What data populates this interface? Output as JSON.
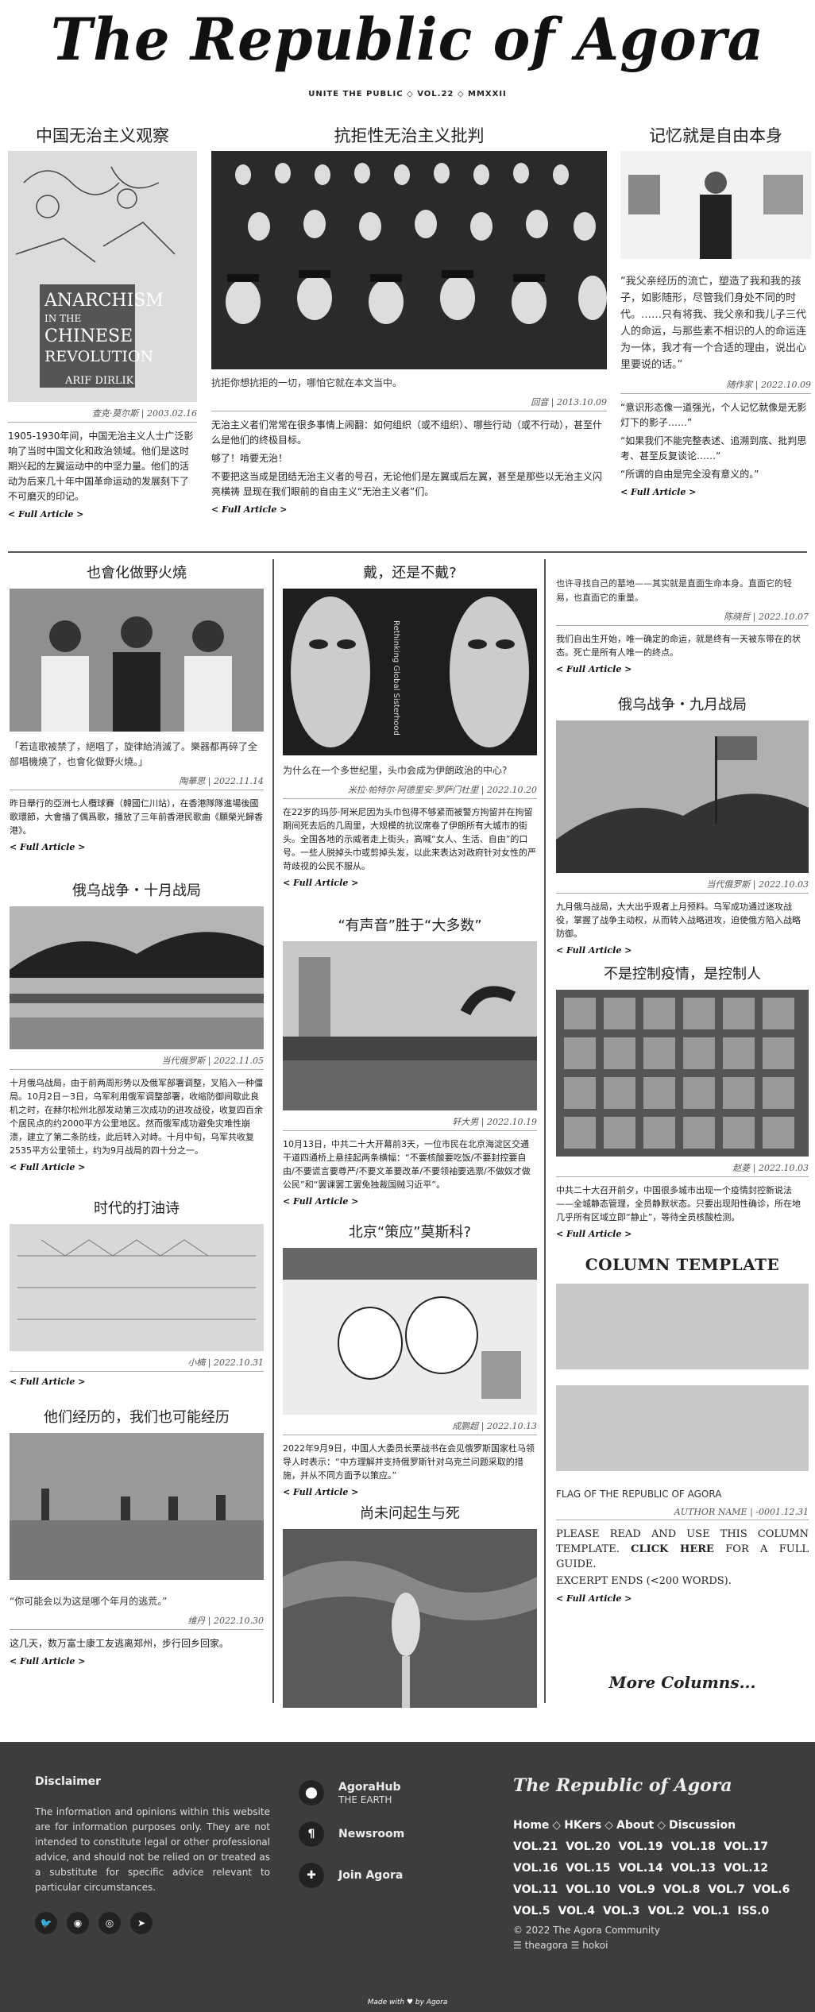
{
  "masthead": {
    "title": "The Republic of Agora",
    "tagline": "UNITE THE PUBLIC ◇ VOL.22 ◇ MMXXII"
  },
  "articles": {
    "a1": {
      "title": "中国无治主义观察",
      "image_alt": "ANARCHISM IN THE CHINESE REVOLUTION — ARIF DIRLIK",
      "author": "查克·莫尔斯",
      "date": "2003.02.16",
      "body": "1905-1930年间，中国无治主义人士广泛影响了当时中国文化和政治领域。他们是这时期兴起的左翼运动中的中坚力量。他们的活动为后来几十年中国革命运动的发展刻下了不可磨灭的印记。",
      "more": "< Full Article >"
    },
    "a2": {
      "title": "抗拒性无治主义批判",
      "caption": "抗拒你想抗拒的一切，哪怕它就在本文当中。",
      "author": "回音",
      "date": "2013.10.09",
      "body1": "无治主义者们常常在很多事情上闹翻：如何组织（或不组织）、哪些行动（或不行动），甚至什么是他们的终极目标。",
      "body2": "够了！啃要无治！",
      "body3": "不要把这当成是团结无治主义者的号召，无论他们是左翼或后左翼，甚至是那些以无治主义闪亮横祷 显现在我们眼前的自由主义“无治主义者”们。",
      "more": "< Full Article >"
    },
    "a3": {
      "title": "记忆就是自由本身",
      "quote": "“我父亲经历的流亡，塑造了我和我的孩子，如影随形，尽管我们身处不同的时代。……只有将我、我父亲和我儿子三代人的命运，与那些素不相识的人的命运连为一体，我才有一个合适的理由，说出心里要说的话。”",
      "author": "随作家",
      "date": "2022.10.09",
      "body1": "“意识形态像一道强光，个人记忆就像是无影灯下的影子……”",
      "body2": "“如果我们不能完整表述、追溯到底、批判思考、甚至反复谈论……”",
      "body3": "“所谓的自由是完全没有意义的。”",
      "more": "< Full Article >"
    },
    "a3b": {
      "body1": "也许寻找自己的墓地——其实就是直面生命本身。直面它的轻易，也直面它的重量。",
      "author": "陈晓哲",
      "date": "2022.10.07",
      "body2": "我们自出生开始，唯一确定的命运，就是终有一天被东带在的状态。死亡是所有人唯一的终点。",
      "more": "< Full Article >"
    },
    "a4": {
      "title": "也會化做野火燒",
      "quote": "「若這歌被禁了，絕唱了，旋律給消滅了。樂器都再碎了全部唱機燒了，也會化做野火燒。」",
      "author": "陶華思",
      "date": "2022.11.14",
      "body": "昨日舉行的亞洲七人欖球賽（韓國仁川站），在香港隊隊進場後國歌環節，大會播了偶爲歌，播放了三年前香港民歌曲《願榮光歸香港》。",
      "more": "< Full Article >"
    },
    "a5": {
      "title": "戴，还是不戴?",
      "caption": "为什么在一个多世纪里，头巾会成为伊朗政治的中心?",
      "author": "米拉·帕特尔·阿德里安·罗萨门杜里",
      "date": "2022.10.20",
      "body": "在22岁的玛莎·阿米尼因为头巾包得不够紧而被警方拘留并在拘留期间死去后的几周里，大规模的抗议席卷了伊朗所有大城市的街头。全国各地的示威者走上街头，高喊“女人、生活、自由”的口号。一些人脱掉头巾或剪掉头发，以此来表达对政府针对女性的严苛歧视的公民不服从。",
      "more": "< Full Article >"
    },
    "a6": {
      "title": "俄乌战争・九月战局",
      "author": "当代俄罗斯",
      "date": "2022.10.03",
      "body": "九月俄乌战局，大大出乎观者上月预料。乌军成功通过迷攻战役，掌握了战争主动权，从而转入战略进攻，迫使俄方陷入战略防御。",
      "more": "< Full Article >"
    },
    "a7": {
      "title": "俄乌战争・十月战局",
      "author": "当代俄罗斯",
      "date": "2022.11.05",
      "body": "十月俄乌战局，由于前两周形势以及俄军部署调整，叉陷入一种僵局。10月2日－3日，乌军利用俄军调整部署，收缩防御间歇此良机之时，在赫尔松州北部发动第三次成功的进攻战役，收复四百余个居民点的约2000平方公里地区。然而俄军成功避免灾难性崩溃，建立了第二条防线，此后转入对峙。十月中旬，乌军共收复2535平方公里领土，约为9月战局的四十分之一。",
      "more": "< Full Article >"
    },
    "a8": {
      "title": "“有声音”胜于“大多数”",
      "author": "轩大男",
      "date": "2022.10.19",
      "body": "10月13日，中共二十大开幕前3天，一位市民在北京海淀区交通干道四通桥上悬挂起两条横幅：“不要核酸要吃饭/不要封控要自由/不要谎言要尊严/不要文革要改革/不要领袖要选票/不做奴才做公民”和“罢课罢工罢免独裁国贼习近平”。",
      "more": "< Full Article >"
    },
    "a9": {
      "title": "不是控制疫情，是控制人",
      "author": "赵菱",
      "date": "2022.10.03",
      "body": "中共二十大召开前夕，中国很多城市出现一个疫情封控新说法——全城静态管理，全员静默状态。只要出现阳性确诊，所在地几乎所有区域立即“静止”，等待全员核酸检测。",
      "more": "< Full Article >"
    },
    "a10": {
      "title": "时代的打油诗",
      "author": "小楠",
      "date": "2022.10.31",
      "more": "< Full Article >"
    },
    "a11": {
      "title": "北京“策应”莫斯科?",
      "author": "成鹏超",
      "date": "2022.10.13",
      "body": "2022年9月9日，中国人大委员长栗战书在会见俄罗斯国家杜马领导人时表示：“中方理解并支持俄罗斯针对乌克兰问题采取的措施，并从不同方面予以策应。”",
      "more": "< Full Article >"
    },
    "a12": {
      "title": "他们经历的，我们也可能经历",
      "quote": "“你可能会以为这是哪个年月的逃荒。”",
      "author": "维丹",
      "date": "2022.10.30",
      "body": "这几天，数万富士康工友逃离郑州，步行回乡回家。",
      "more": "< Full Article >"
    },
    "a13": {
      "title": "尚未问起生与死"
    },
    "template": {
      "title": "COLUMN TEMPLATE",
      "flag": "FLAG OF THE REPUBLIC OF AGORA",
      "author": "AUTHOR NAME",
      "date": "-0001.12.31",
      "text1": "PLEASE READ AND USE THIS COLUMN TEMPLATE. ",
      "link": "CLICK HERE",
      "text2": " FOR A FULL GUIDE.",
      "text3": "EXCERPT ENDS (<200 WORDS).",
      "more": "< Full Article >"
    },
    "more_columns": "More Columns..."
  },
  "footer": {
    "disclaimer_title": "Disclaimer",
    "disclaimer": "The information and opinions within this website are for information purposes only. They are not intended to constitute legal or other professional advice, and should not be relied on or treated as a substitute for specific advice relevant to particular circumstances.",
    "links": [
      {
        "title": "AgoraHub",
        "sub": "THE EARTH"
      },
      {
        "title": "Newsroom",
        "sub": ""
      },
      {
        "title": "Join Agora",
        "sub": ""
      }
    ],
    "brand": "The Republic of Agora",
    "nav": [
      "Home",
      "HKers",
      "About",
      "Discussion"
    ],
    "vols": [
      "VOL.21",
      "VOL.20",
      "VOL.19",
      "VOL.18",
      "VOL.17",
      "VOL.16",
      "VOL.15",
      "VOL.14",
      "VOL.13",
      "VOL.12",
      "VOL.11",
      "VOL.10",
      "VOL.9",
      "VOL.8",
      "VOL.7",
      "VOL.6",
      "VOL.5",
      "VOL.4",
      "VOL.3",
      "VOL.2",
      "VOL.1",
      "ISS.0"
    ],
    "copyright": "© 2022 The Agora Community",
    "credits": "☰ theagora ☰ hokoi",
    "made": "Made with ♥ by Agora"
  },
  "colors": {
    "footer_bg": "#3d3d3d",
    "rule": "#555555",
    "template_box": "#c8c8c8"
  }
}
